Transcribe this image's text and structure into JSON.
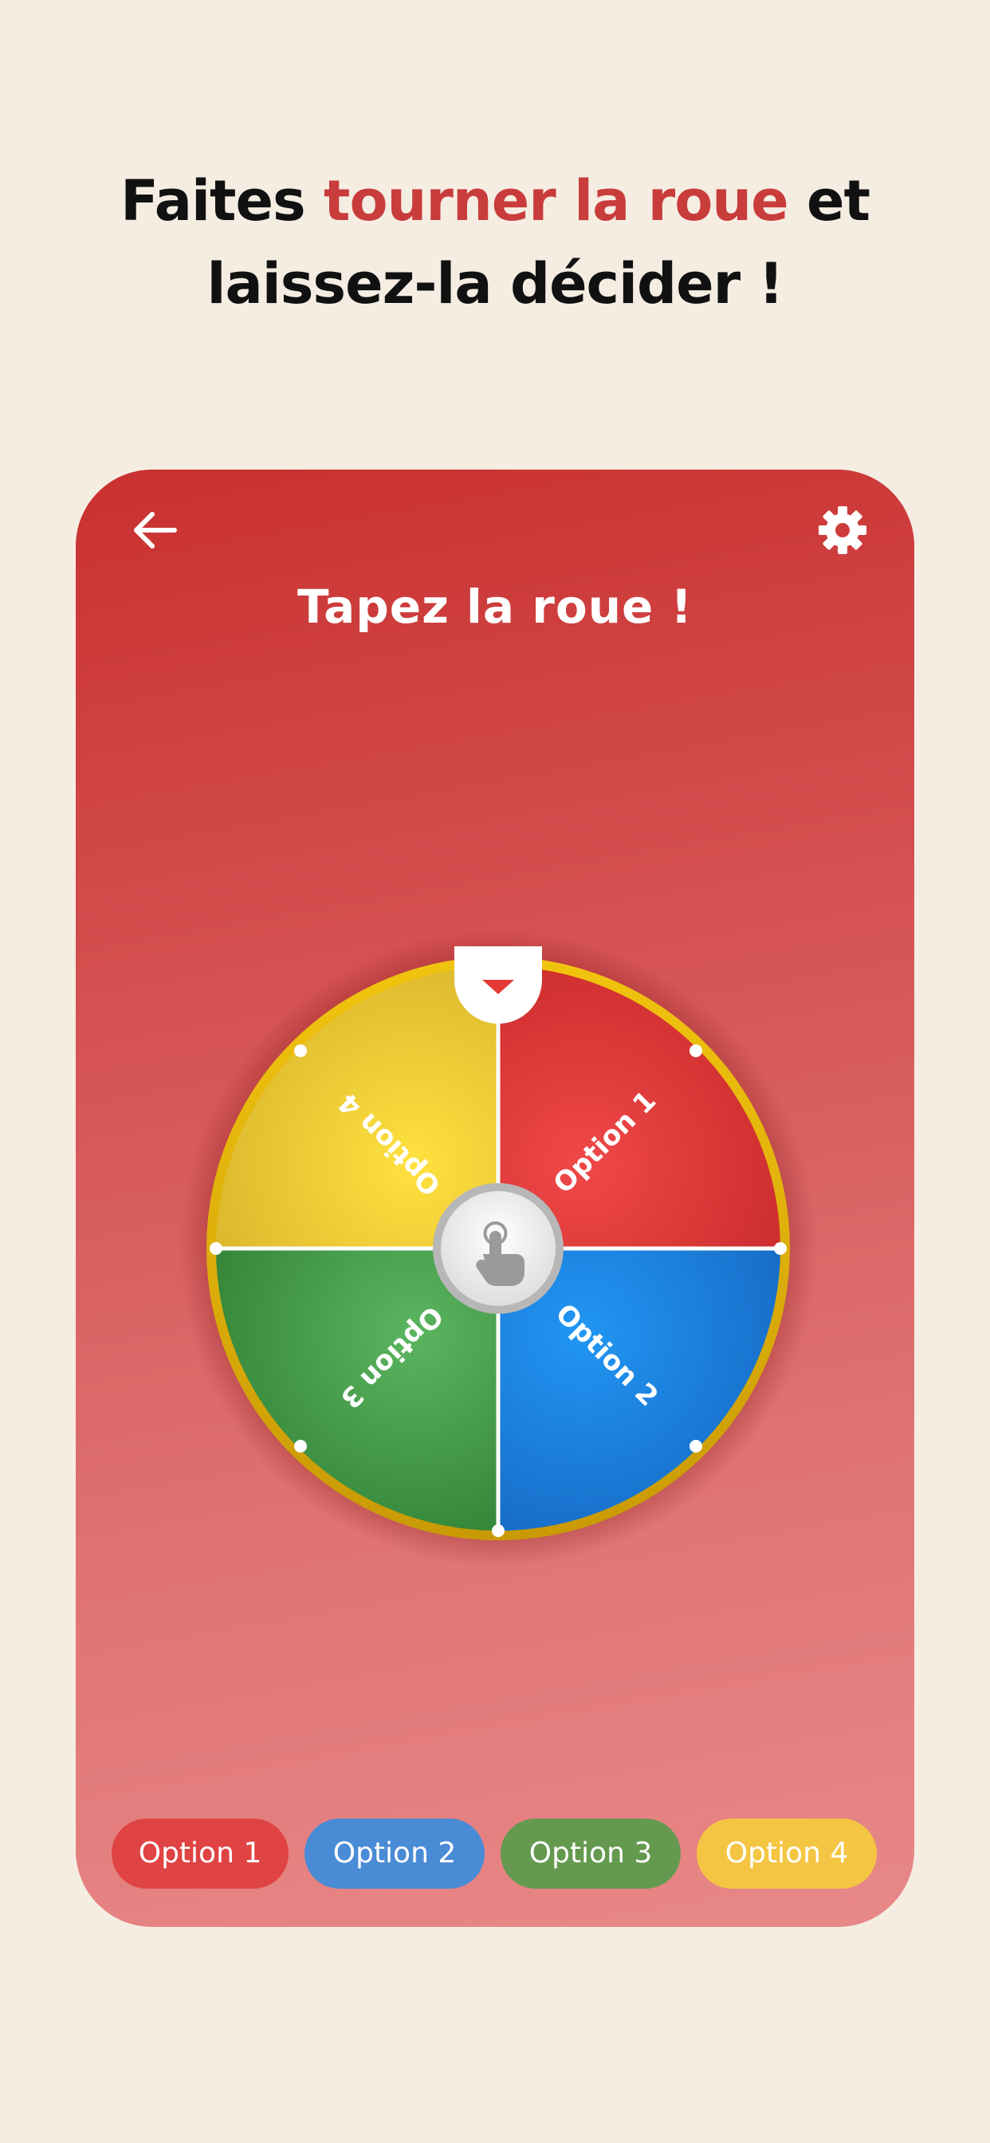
{
  "headline": {
    "part1": "Faites ",
    "accent": "tourner la roue",
    "part2": " et",
    "line2": "laissez-la décider !",
    "accent_color": "#c93c3c"
  },
  "card": {
    "title": "Tapez la roue !",
    "back_icon": "arrow-left-icon",
    "settings_icon": "gear-icon"
  },
  "wheel": {
    "segments": [
      {
        "label": "Option 1",
        "color": "#e53935"
      },
      {
        "label": "Option 2",
        "color": "#1e88e5"
      },
      {
        "label": "Option 3",
        "color": "#43a047"
      },
      {
        "label": "Option 4",
        "color": "#fdd835"
      }
    ],
    "rim_color": "#f3c300",
    "pointer_icon": "triangle-down-icon",
    "center_icon": "hand-tap-icon"
  },
  "chips": [
    {
      "label": "Option 1",
      "color": "#e04343"
    },
    {
      "label": "Option 2",
      "color": "#4a8bd6"
    },
    {
      "label": "Option 3",
      "color": "#64994f"
    },
    {
      "label": "Option 4",
      "color": "#f4c542"
    }
  ]
}
